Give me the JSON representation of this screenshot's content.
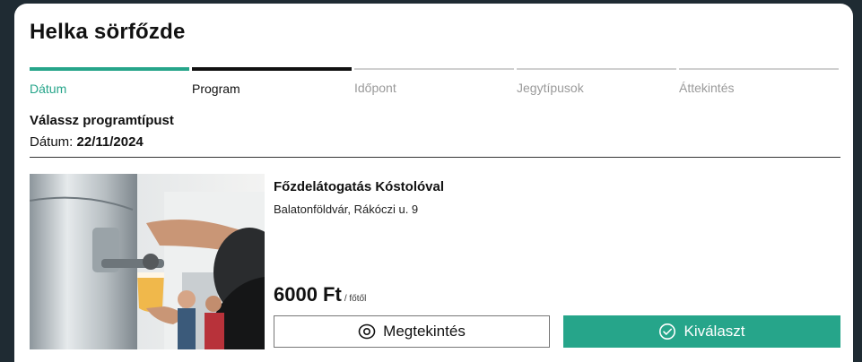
{
  "header": {
    "title": "Helka sörfőzde"
  },
  "steps": [
    {
      "label": "Dátum",
      "state": "active"
    },
    {
      "label": "Program",
      "state": "done"
    },
    {
      "label": "Időpont",
      "state": "pending"
    },
    {
      "label": "Jegytípusok",
      "state": "pending"
    },
    {
      "label": "Áttekintés",
      "state": "pending"
    }
  ],
  "main": {
    "subtitle": "Válassz programtípust",
    "date_label": "Dátum:",
    "date_value": "22/11/2024"
  },
  "program": {
    "name": "Főzdelátogatás Kóstolóval",
    "address": "Balatonföldvár, Rákóczi u. 9",
    "price": "6000 Ft",
    "price_suffix": "/ főtől",
    "view_label": "Megtekintés",
    "view_icon": "eye-icon",
    "select_label": "Kiválaszt",
    "select_icon": "check-circle-icon"
  },
  "colors": {
    "accent": "#26a58a",
    "done": "#111111",
    "pending": "#cfcfcf",
    "background": "#1f2b33"
  }
}
